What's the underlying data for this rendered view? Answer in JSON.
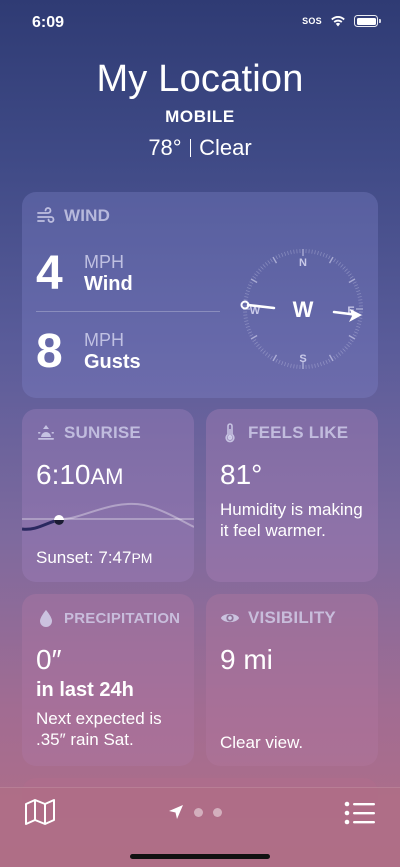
{
  "status": {
    "time": "6:09",
    "sos": "SOS"
  },
  "header": {
    "title": "My Location",
    "subtitle": "MOBILE",
    "temp": "78°",
    "condition": "Clear"
  },
  "wind": {
    "heading": "WIND",
    "wind_value": "4",
    "wind_unit": "MPH",
    "wind_label": "Wind",
    "gust_value": "8",
    "gust_unit": "MPH",
    "gust_label": "Gusts",
    "compass": {
      "n": "N",
      "s": "S",
      "e": "E",
      "w": "W",
      "center": "W"
    }
  },
  "sunrise": {
    "heading": "SUNRISE",
    "time": "6:10",
    "ampm": "AM",
    "sunset_prefix": "Sunset: 7:47",
    "sunset_ampm": "PM"
  },
  "feels_like": {
    "heading": "FEELS LIKE",
    "value": "81°",
    "desc": "Humidity is making it feel warmer."
  },
  "precipitation": {
    "heading": "PRECIPITATION",
    "value": "0″",
    "period": "in last 24h",
    "desc": "Next expected is .35″ rain Sat."
  },
  "visibility": {
    "heading": "VISIBILITY",
    "value": "9 mi",
    "desc": "Clear view."
  },
  "tabbar": {
    "icons": [
      "map-icon",
      "location-arrow-icon",
      "page-dot",
      "page-dot",
      "list-icon"
    ]
  },
  "colors": {
    "card": "#8c8cc8",
    "tabbar": "#af6e87"
  }
}
